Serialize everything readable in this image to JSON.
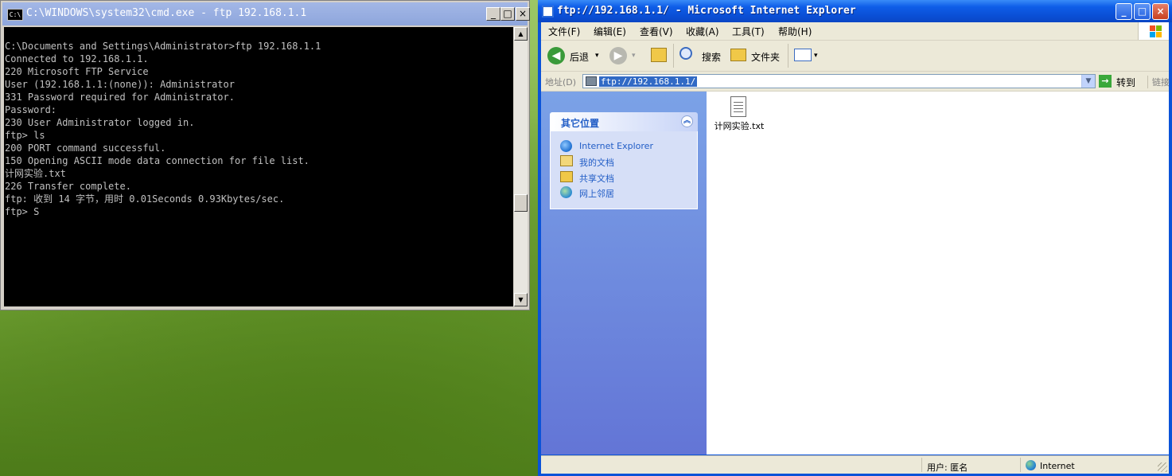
{
  "cmd": {
    "title": "C:\\WINDOWS\\system32\\cmd.exe - ftp 192.168.1.1",
    "icon_text": "C:\\",
    "lines": [
      "",
      "C:\\Documents and Settings\\Administrator>ftp 192.168.1.1",
      "Connected to 192.168.1.1.",
      "220 Microsoft FTP Service",
      "User (192.168.1.1:(none)): Administrator",
      "331 Password required for Administrator.",
      "Password:",
      "230 User Administrator logged in.",
      "ftp> ls",
      "200 PORT command successful.",
      "150 Opening ASCII mode data connection for file list.",
      "计网实验.txt",
      "226 Transfer complete.",
      "ftp: 收到 14 字节，用时 0.01Seconds 0.93Kbytes/sec.",
      "ftp> S"
    ],
    "controls": {
      "minimize": "_",
      "maximize": "□",
      "close": "×"
    }
  },
  "ie": {
    "title": "ftp://192.168.1.1/ - Microsoft Internet Explorer",
    "controls": {
      "minimize": "_",
      "maximize": "□",
      "close": "×"
    },
    "menu": [
      "文件(F)",
      "编辑(E)",
      "查看(V)",
      "收藏(A)",
      "工具(T)",
      "帮助(H)"
    ],
    "toolbar": {
      "back_label": "后退",
      "search_label": "搜索",
      "folders_label": "文件夹",
      "dropdown_glyph": "▾"
    },
    "address": {
      "label": "地址(D)",
      "value": "ftp://192.168.1.1/",
      "go_label": "转到",
      "links_label": "链接"
    },
    "taskpane": {
      "header": "其它位置",
      "collapse_glyph": "︽",
      "links": [
        {
          "label": "Internet Explorer",
          "icon": "ie-icon"
        },
        {
          "label": "我的文档",
          "icon": "my-documents-icon"
        },
        {
          "label": "共享文档",
          "icon": "shared-documents-icon"
        },
        {
          "label": "网上邻居",
          "icon": "network-places-icon"
        }
      ]
    },
    "files": [
      {
        "name": "计网实验.txt",
        "icon": "text-file-icon"
      }
    ],
    "statusbar": {
      "user": "用户: 匿名",
      "zone": "Internet"
    },
    "colors": {
      "titlebar": "#0a4fd6",
      "taskpane_top": "#7ba2e7",
      "taskpane_bottom": "#6375d6",
      "link": "#215dc6",
      "address_selection": "#316ac5"
    }
  }
}
